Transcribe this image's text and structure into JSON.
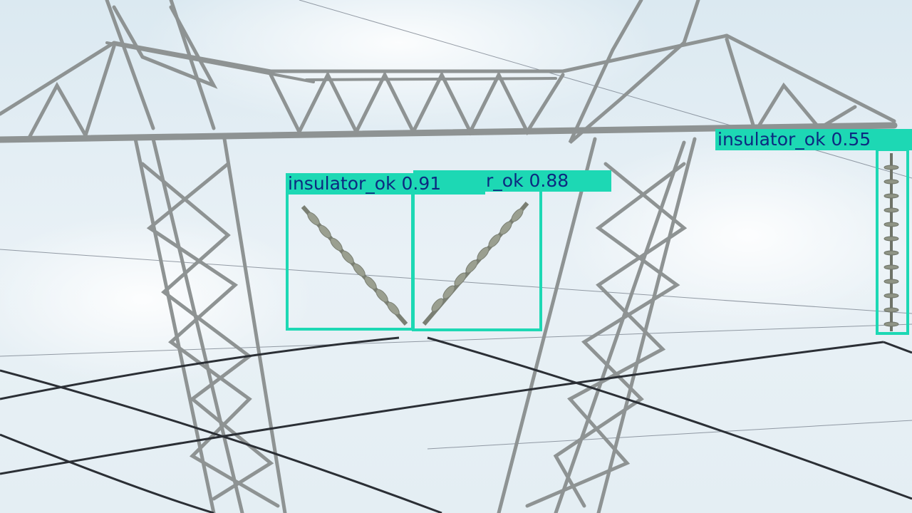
{
  "scene": {
    "subject": "power-transmission-tower",
    "sky_color": "#e4eef4",
    "steel_color": "#8c9191",
    "insulator_color": "#7d8274",
    "wire_color": "#2a2e33"
  },
  "detections": [
    {
      "id": "d1",
      "label": "insulator_ok 0.91",
      "class": "insulator_ok",
      "confidence": 0.91,
      "color": "#1dd8b4"
    },
    {
      "id": "d2",
      "label": "insulator_ok 0.88",
      "class": "insulator_ok",
      "confidence": 0.88,
      "color": "#1dd8b4"
    },
    {
      "id": "d3",
      "label": "insulator_ok 0.55",
      "class": "insulator_ok",
      "confidence": 0.55,
      "color": "#1dd8b4"
    }
  ],
  "label_text_color": "#0c2a80"
}
